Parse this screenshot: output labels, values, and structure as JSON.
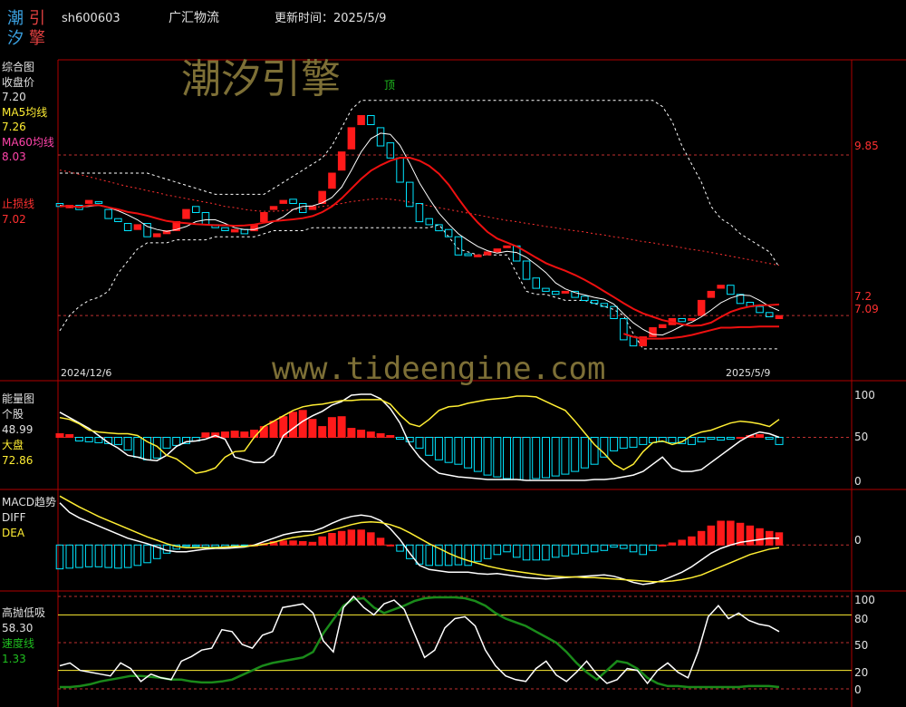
{
  "header": {
    "logo_chars": [
      "潮",
      "引",
      "汐",
      "擎"
    ],
    "code": "sh600603",
    "name": "广汇物流",
    "update_label": "更新时间：2025/5/9"
  },
  "watermark": {
    "brand": "潮汐引擎",
    "url": "www.tideengine.com"
  },
  "colors": {
    "bg": "#000000",
    "border": "#b00000",
    "up": "#ff1a1a",
    "down": "#00e5ff",
    "ma5": "#ffffff",
    "ma60": "#ff2020",
    "yellow": "#ffee33",
    "green": "#1a8a1a",
    "grid_red": "#c03030",
    "tick_red": "#ff3030",
    "watermark": "#8a7a3a"
  },
  "chart_data": [
    {
      "type": "candlestick",
      "panel_label": "综合图",
      "legend": [
        {
          "label": "收盘价",
          "value": "7.20"
        },
        {
          "label": "MA5均线",
          "value": "7.26"
        },
        {
          "label": "MA60均线",
          "value": "8.03"
        },
        {
          "label": "止损线",
          "value": "7.02"
        }
      ],
      "annotation": "顶",
      "x_start_label": "2024/12/6",
      "x_end_label": "2025/5/9",
      "y_ticks": [
        "9.85",
        "7.2",
        "7.09"
      ],
      "ylim": [
        6.35,
        11.3
      ],
      "close": [
        9.0,
        9.02,
        8.95,
        9.1,
        9.05,
        8.8,
        8.75,
        8.6,
        8.7,
        8.5,
        8.55,
        8.6,
        8.75,
        8.95,
        8.9,
        8.7,
        8.65,
        8.6,
        8.62,
        8.55,
        8.7,
        8.9,
        9.0,
        9.1,
        9.05,
        8.9,
        9.0,
        9.25,
        9.55,
        9.9,
        10.3,
        10.5,
        10.35,
        10.0,
        9.8,
        9.4,
        9.0,
        8.75,
        8.7,
        8.6,
        8.5,
        8.2,
        8.2,
        8.2,
        8.25,
        8.3,
        8.35,
        8.1,
        7.8,
        7.65,
        7.6,
        7.55,
        7.6,
        7.5,
        7.45,
        7.4,
        7.35,
        7.15,
        6.8,
        6.7,
        6.85,
        7.0,
        7.05,
        7.15,
        7.1,
        7.15,
        7.45,
        7.6,
        7.7,
        7.55,
        7.4,
        7.35,
        7.25,
        7.18,
        7.2
      ],
      "open": [
        9.05,
        8.98,
        9.02,
        9.05,
        9.08,
        8.95,
        8.8,
        8.72,
        8.62,
        8.72,
        8.5,
        8.55,
        8.6,
        8.8,
        9.0,
        8.9,
        8.7,
        8.65,
        8.58,
        8.62,
        8.6,
        8.75,
        8.95,
        9.05,
        9.12,
        9.05,
        8.95,
        9.05,
        9.3,
        9.6,
        9.95,
        10.35,
        10.5,
        10.3,
        10.05,
        9.8,
        9.4,
        9.05,
        8.8,
        8.7,
        8.62,
        8.5,
        8.22,
        8.18,
        8.2,
        8.25,
        8.32,
        8.35,
        8.1,
        7.82,
        7.65,
        7.6,
        7.58,
        7.6,
        7.52,
        7.45,
        7.4,
        7.35,
        7.15,
        6.85,
        6.7,
        6.85,
        7.0,
        7.05,
        7.15,
        7.12,
        7.2,
        7.5,
        7.65,
        7.7,
        7.55,
        7.42,
        7.35,
        7.25,
        7.15
      ],
      "ma5": [
        9.02,
        9.0,
        8.99,
        9.0,
        9.02,
        8.98,
        8.93,
        8.86,
        8.78,
        8.67,
        8.62,
        8.59,
        8.62,
        8.67,
        8.75,
        8.78,
        8.78,
        8.72,
        8.65,
        8.62,
        8.62,
        8.67,
        8.75,
        8.83,
        8.95,
        9.0,
        9.01,
        9.06,
        9.15,
        9.32,
        9.6,
        9.9,
        10.12,
        10.21,
        10.19,
        10.01,
        9.71,
        9.39,
        9.13,
        8.89,
        8.71,
        8.55,
        8.44,
        8.34,
        8.27,
        8.23,
        8.26,
        8.24,
        8.16,
        8.04,
        7.91,
        7.74,
        7.64,
        7.58,
        7.54,
        7.5,
        7.47,
        7.39,
        7.23,
        7.08,
        6.97,
        6.89,
        6.88,
        6.95,
        7.03,
        7.09,
        7.18,
        7.29,
        7.41,
        7.49,
        7.54,
        7.53,
        7.45,
        7.35,
        7.28
      ],
      "ma60": [
        9.6,
        9.57,
        9.53,
        9.49,
        9.45,
        9.41,
        9.37,
        9.33,
        9.3,
        9.26,
        9.23,
        9.19,
        9.16,
        9.13,
        9.1,
        9.07,
        9.04,
        9.0,
        8.98,
        8.95,
        8.93,
        8.92,
        8.92,
        8.93,
        8.95,
        8.96,
        8.98,
        9.0,
        9.02,
        9.05,
        9.08,
        9.1,
        9.12,
        9.13,
        9.12,
        9.1,
        9.07,
        9.04,
        9.01,
        8.98,
        8.95,
        8.92,
        8.89,
        8.86,
        8.83,
        8.8,
        8.77,
        8.75,
        8.72,
        8.7,
        8.67,
        8.65,
        8.62,
        8.6,
        8.58,
        8.55,
        8.53,
        8.5,
        8.48,
        8.45,
        8.42,
        8.4,
        8.37,
        8.35,
        8.32,
        8.29,
        8.27,
        8.24,
        8.21,
        8.18,
        8.15,
        8.12,
        8.09,
        8.06,
        8.03
      ],
      "band_upper": [
        9.55,
        9.55,
        9.55,
        9.55,
        9.55,
        9.55,
        9.55,
        9.55,
        9.55,
        9.55,
        9.5,
        9.45,
        9.4,
        9.35,
        9.3,
        9.25,
        9.2,
        9.2,
        9.2,
        9.2,
        9.2,
        9.2,
        9.3,
        9.4,
        9.5,
        9.6,
        9.7,
        9.8,
        10.0,
        10.3,
        10.6,
        10.75,
        10.75,
        10.75,
        10.75,
        10.75,
        10.75,
        10.75,
        10.75,
        10.75,
        10.75,
        10.75,
        10.75,
        10.75,
        10.75,
        10.75,
        10.75,
        10.75,
        10.75,
        10.75,
        10.75,
        10.75,
        10.75,
        10.75,
        10.75,
        10.75,
        10.75,
        10.75,
        10.75,
        10.75,
        10.75,
        10.75,
        10.65,
        10.4,
        10.0,
        9.7,
        9.4,
        9.0,
        8.8,
        8.7,
        8.55,
        8.45,
        8.35,
        8.25,
        8.0
      ],
      "band_lower": [
        6.95,
        7.2,
        7.35,
        7.45,
        7.5,
        7.6,
        7.9,
        8.1,
        8.3,
        8.4,
        8.4,
        8.4,
        8.45,
        8.45,
        8.45,
        8.45,
        8.5,
        8.5,
        8.5,
        8.5,
        8.5,
        8.55,
        8.6,
        8.6,
        8.6,
        8.6,
        8.65,
        8.65,
        8.65,
        8.65,
        8.65,
        8.65,
        8.65,
        8.65,
        8.65,
        8.65,
        8.65,
        8.65,
        8.65,
        8.7,
        8.5,
        8.3,
        8.25,
        8.2,
        8.2,
        8.2,
        8.2,
        7.9,
        7.6,
        7.55,
        7.55,
        7.5,
        7.45,
        7.45,
        7.45,
        7.4,
        7.35,
        7.3,
        7.2,
        6.9,
        6.65,
        6.65,
        6.65,
        6.65,
        6.65,
        6.65,
        6.65,
        6.65,
        6.65,
        6.65,
        6.65,
        6.65,
        6.65,
        6.65,
        6.65
      ],
      "stop_loss": [
        null,
        null,
        null,
        null,
        null,
        null,
        null,
        null,
        null,
        null,
        null,
        null,
        null,
        null,
        null,
        null,
        null,
        null,
        null,
        null,
        null,
        null,
        null,
        null,
        null,
        null,
        null,
        null,
        null,
        null,
        null,
        null,
        null,
        null,
        null,
        null,
        null,
        null,
        null,
        null,
        null,
        null,
        null,
        null,
        null,
        null,
        null,
        null,
        null,
        null,
        null,
        null,
        null,
        null,
        null,
        null,
        null,
        null,
        6.9,
        6.85,
        6.82,
        6.82,
        6.82,
        6.83,
        6.85,
        6.88,
        6.92,
        6.96,
        7.0,
        7.0,
        7.01,
        7.01,
        7.02,
        7.02,
        7.02
      ]
    },
    {
      "type": "bar+line",
      "panel_label": "能量图",
      "legend": [
        {
          "label": "个股",
          "value": "48.99"
        },
        {
          "label": "大盘",
          "value": "72.86"
        }
      ],
      "y_ticks": [
        "100",
        "50",
        "0"
      ],
      "ylim": [
        0,
        100
      ],
      "bars": [
        54,
        53,
        46,
        45,
        44,
        43,
        42,
        36,
        28,
        25,
        27,
        38,
        41,
        43,
        46,
        55,
        55,
        56,
        57,
        56,
        58,
        62,
        68,
        73,
        78,
        80,
        70,
        62,
        72,
        73,
        60,
        58,
        56,
        54,
        52,
        48,
        45,
        38,
        30,
        25,
        22,
        20,
        16,
        12,
        8,
        6,
        4,
        3,
        2,
        4,
        5,
        7,
        9,
        12,
        16,
        20,
        28,
        35,
        38,
        39,
        42,
        44,
        45,
        44,
        43,
        42,
        45,
        48,
        47,
        48,
        50,
        52,
        53,
        48,
        42
      ],
      "line_white": [
        78,
        72,
        66,
        60,
        52,
        44,
        38,
        30,
        28,
        25,
        24,
        30,
        40,
        45,
        46,
        48,
        52,
        48,
        28,
        25,
        22,
        22,
        30,
        52,
        60,
        68,
        74,
        79,
        86,
        90,
        97,
        98,
        98,
        93,
        82,
        66,
        42,
        28,
        18,
        10,
        8,
        6,
        5,
        4,
        3,
        3,
        3,
        3,
        2,
        2,
        2,
        2,
        2,
        2,
        2,
        3,
        3,
        4,
        6,
        8,
        12,
        20,
        28,
        16,
        12,
        12,
        14,
        22,
        30,
        38,
        46,
        52,
        56,
        54,
        50
      ],
      "line_yellow": [
        72,
        70,
        65,
        58,
        56,
        55,
        54,
        54,
        52,
        45,
        40,
        30,
        26,
        18,
        10,
        12,
        16,
        28,
        34,
        35,
        50,
        62,
        68,
        74,
        80,
        84,
        86,
        87,
        89,
        91,
        91,
        92,
        92,
        92,
        87,
        75,
        65,
        62,
        70,
        80,
        84,
        85,
        88,
        90,
        92,
        93,
        94,
        96,
        96,
        95,
        90,
        85,
        80,
        68,
        55,
        42,
        32,
        20,
        14,
        20,
        34,
        44,
        46,
        42,
        45,
        52,
        56,
        58,
        62,
        66,
        68,
        67,
        65,
        62,
        70
      ]
    },
    {
      "type": "macd",
      "panel_label": "MACD趋势",
      "legend": [
        {
          "label": "DIFF",
          "value": ""
        },
        {
          "label": "DEA",
          "value": ""
        }
      ],
      "y_ticks": [
        "0"
      ],
      "ylim": [
        -0.65,
        0.75
      ],
      "hist": [
        -0.35,
        -0.34,
        -0.33,
        -0.32,
        -0.32,
        -0.33,
        -0.34,
        -0.33,
        -0.3,
        -0.26,
        -0.2,
        -0.12,
        -0.06,
        -0.02,
        -0.02,
        -0.03,
        -0.03,
        -0.03,
        -0.02,
        -0.01,
        0,
        0.02,
        0.05,
        0.06,
        0.06,
        0.05,
        0.04,
        0.12,
        0.17,
        0.2,
        0.22,
        0.22,
        0.18,
        0.1,
        0,
        -0.09,
        -0.2,
        -0.28,
        -0.3,
        -0.3,
        -0.3,
        -0.29,
        -0.3,
        -0.24,
        -0.2,
        -0.14,
        -0.1,
        -0.18,
        -0.22,
        -0.22,
        -0.22,
        -0.18,
        -0.16,
        -0.13,
        -0.12,
        -0.1,
        -0.08,
        -0.03,
        -0.05,
        -0.1,
        -0.14,
        -0.08,
        0,
        0.03,
        0.07,
        0.12,
        0.2,
        0.28,
        0.35,
        0.35,
        0.32,
        0.28,
        0.24,
        0.2,
        0.18
      ],
      "diff": [
        0.62,
        0.48,
        0.4,
        0.34,
        0.28,
        0.22,
        0.16,
        0.1,
        0.06,
        0.02,
        -0.03,
        -0.08,
        -0.1,
        -0.1,
        -0.08,
        -0.06,
        -0.05,
        -0.05,
        -0.04,
        -0.03,
        0,
        0.05,
        0.1,
        0.15,
        0.18,
        0.2,
        0.2,
        0.25,
        0.32,
        0.38,
        0.42,
        0.44,
        0.42,
        0.36,
        0.24,
        0.08,
        -0.12,
        -0.3,
        -0.36,
        -0.38,
        -0.4,
        -0.4,
        -0.4,
        -0.42,
        -0.43,
        -0.42,
        -0.44,
        -0.46,
        -0.48,
        -0.49,
        -0.5,
        -0.49,
        -0.48,
        -0.47,
        -0.46,
        -0.45,
        -0.44,
        -0.46,
        -0.5,
        -0.55,
        -0.58,
        -0.56,
        -0.52,
        -0.46,
        -0.4,
        -0.32,
        -0.22,
        -0.12,
        -0.05,
        0,
        0.04,
        0.06,
        0.08,
        0.1,
        0.1
      ],
      "dea": [
        0.72,
        0.64,
        0.56,
        0.49,
        0.42,
        0.36,
        0.3,
        0.24,
        0.18,
        0.12,
        0.07,
        0.02,
        -0.02,
        -0.04,
        -0.04,
        -0.04,
        -0.04,
        -0.03,
        -0.02,
        -0.02,
        -0.01,
        0.01,
        0.04,
        0.08,
        0.11,
        0.13,
        0.15,
        0.18,
        0.22,
        0.26,
        0.3,
        0.33,
        0.34,
        0.33,
        0.3,
        0.25,
        0.18,
        0.1,
        0.02,
        -0.05,
        -0.12,
        -0.18,
        -0.23,
        -0.27,
        -0.31,
        -0.34,
        -0.37,
        -0.39,
        -0.41,
        -0.43,
        -0.45,
        -0.46,
        -0.47,
        -0.47,
        -0.48,
        -0.48,
        -0.49,
        -0.5,
        -0.51,
        -0.52,
        -0.53,
        -0.54,
        -0.54,
        -0.53,
        -0.51,
        -0.48,
        -0.44,
        -0.38,
        -0.32,
        -0.26,
        -0.2,
        -0.14,
        -0.1,
        -0.06,
        -0.04
      ]
    },
    {
      "type": "line",
      "panel_label": "高抛低吸",
      "legend": [
        {
          "label": "",
          "value": "58.30"
        },
        {
          "label": "速度线",
          "value": "1.33"
        }
      ],
      "y_ticks": [
        "100",
        "80",
        "50",
        "20",
        "0"
      ],
      "ylim": [
        0,
        100
      ],
      "line_white": [
        25,
        28,
        20,
        18,
        16,
        14,
        28,
        22,
        8,
        16,
        12,
        10,
        30,
        35,
        42,
        44,
        64,
        62,
        48,
        44,
        58,
        62,
        88,
        90,
        92,
        82,
        52,
        40,
        88,
        100,
        88,
        80,
        92,
        96,
        86,
        60,
        34,
        42,
        66,
        76,
        78,
        68,
        42,
        25,
        14,
        10,
        8,
        22,
        30,
        15,
        8,
        18,
        30,
        16,
        6,
        10,
        22,
        20,
        6,
        20,
        28,
        18,
        12,
        40,
        78,
        90,
        76,
        82,
        74,
        70,
        68,
        62
      ],
      "line_green": [
        2,
        2,
        3,
        5,
        8,
        10,
        12,
        14,
        14,
        13,
        12,
        10,
        10,
        8,
        7,
        7,
        8,
        10,
        15,
        20,
        25,
        28,
        30,
        32,
        34,
        40,
        60,
        75,
        90,
        97,
        98,
        88,
        82,
        86,
        90,
        95,
        98,
        99,
        99,
        99,
        98,
        95,
        90,
        82,
        76,
        72,
        68,
        62,
        56,
        50,
        40,
        28,
        18,
        10,
        20,
        30,
        28,
        22,
        12,
        6,
        3,
        3,
        2,
        2,
        2,
        2,
        2,
        2,
        3,
        3,
        3,
        2
      ]
    }
  ]
}
